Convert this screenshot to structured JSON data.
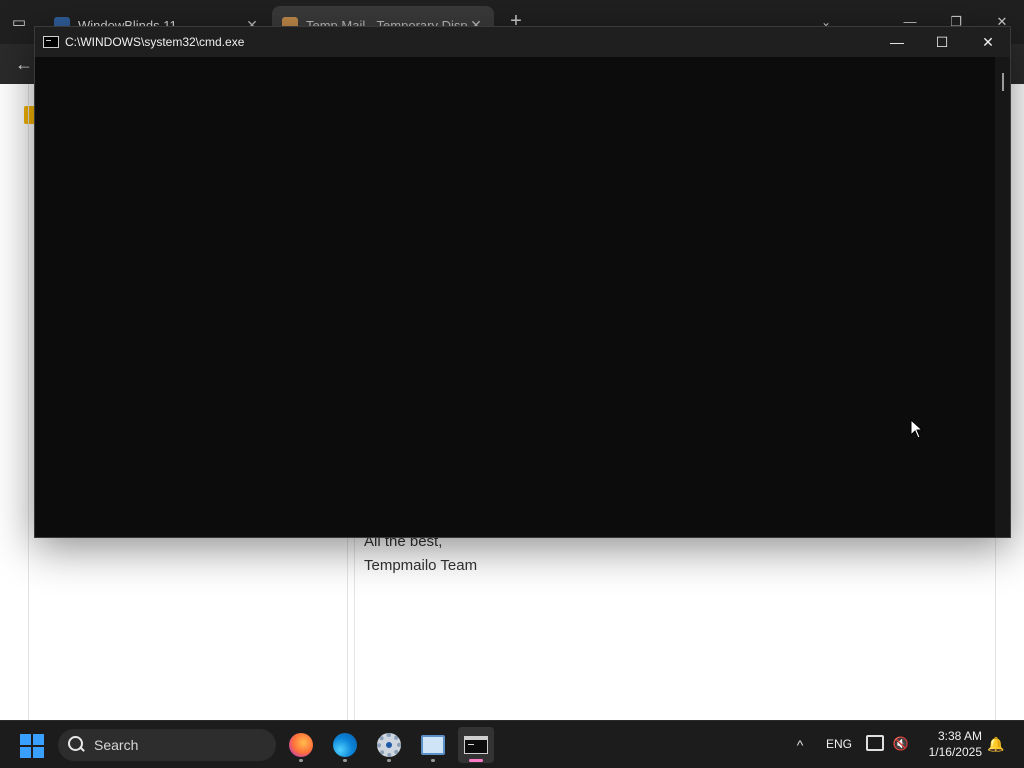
{
  "browser": {
    "tabs": [
      {
        "title": "WindowBlinds 11",
        "close": "✕"
      },
      {
        "title": "Temp Mail - Temporary Dispos",
        "close": "✕"
      }
    ],
    "new_tab": "+",
    "tab_list": "⌄",
    "controls": {
      "minimize": "—",
      "restore": "❐",
      "close": "✕"
    },
    "back": "←"
  },
  "email": {
    "signoff": "All the best,",
    "signature": "Tempmailo Team"
  },
  "cmd": {
    "title": "C:\\WINDOWS\\system32\\cmd.exe",
    "controls": {
      "minimize": "—",
      "maximize": "☐",
      "close": "✕"
    }
  },
  "taskbar": {
    "search_label": "Search",
    "apps": [
      "firefox-icon",
      "edge-icon",
      "settings-icon",
      "remote-desktop-icon",
      "terminal-icon"
    ],
    "tray_chevron": "^",
    "language": "ENG",
    "time": "3:38 AM",
    "date": "1/16/2025",
    "accent": "#3aa0ff"
  }
}
